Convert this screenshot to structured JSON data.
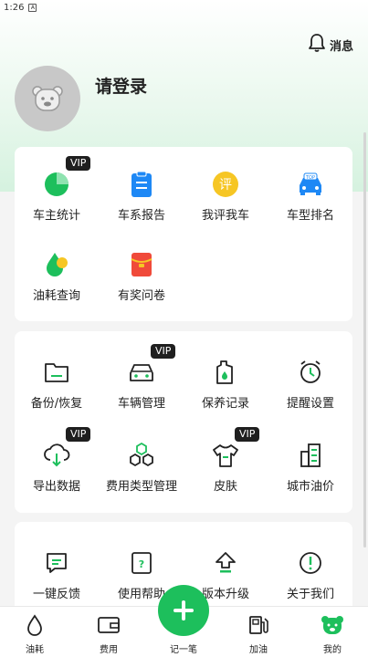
{
  "status": {
    "time": "1:26",
    "sim": "A"
  },
  "header": {
    "message_label": "消息",
    "login_label": "请登录"
  },
  "section1": {
    "items": [
      {
        "label": "车主统计",
        "icon": "pie-chart-icon",
        "vip": "VIP"
      },
      {
        "label": "车系报告",
        "icon": "report-clipboard-icon"
      },
      {
        "label": "我评我车",
        "icon": "review-icon",
        "glyph": "评"
      },
      {
        "label": "车型排名",
        "icon": "car-top-ranking-icon",
        "glyph": "TOP"
      },
      {
        "label": "油耗查询",
        "icon": "fuel-drop-icon"
      },
      {
        "label": "有奖问卷",
        "icon": "red-envelope-icon"
      }
    ]
  },
  "section2": {
    "items": [
      {
        "label": "备份/恢复",
        "icon": "folder-icon"
      },
      {
        "label": "车辆管理",
        "icon": "car-icon",
        "vip": "VIP"
      },
      {
        "label": "保养记录",
        "icon": "oil-bottle-icon"
      },
      {
        "label": "提醒设置",
        "icon": "alarm-clock-icon"
      },
      {
        "label": "导出数据",
        "icon": "cloud-download-icon",
        "vip": "VIP"
      },
      {
        "label": "费用类型管理",
        "icon": "hexagons-icon"
      },
      {
        "label": "皮肤",
        "icon": "tshirt-icon",
        "vip": "VIP"
      },
      {
        "label": "城市油价",
        "icon": "building-icon"
      }
    ]
  },
  "section3": {
    "items": [
      {
        "label": "一键反馈",
        "icon": "feedback-icon"
      },
      {
        "label": "使用帮助",
        "icon": "help-icon"
      },
      {
        "label": "版本升级",
        "icon": "upgrade-icon"
      },
      {
        "label": "关于我们",
        "icon": "info-icon"
      }
    ]
  },
  "tabbar": {
    "tabs": [
      {
        "label": "油耗",
        "icon": "drop-icon"
      },
      {
        "label": "费用",
        "icon": "wallet-icon"
      },
      {
        "label": "记一笔",
        "icon": "plus-icon"
      },
      {
        "label": "加油",
        "icon": "gas-pump-icon"
      },
      {
        "label": "我的",
        "icon": "bear-icon",
        "active": true
      }
    ]
  },
  "colors": {
    "accent": "#1dbf5c",
    "blue": "#1e88f5",
    "yellow": "#f6c624",
    "red": "#f04a3a"
  }
}
